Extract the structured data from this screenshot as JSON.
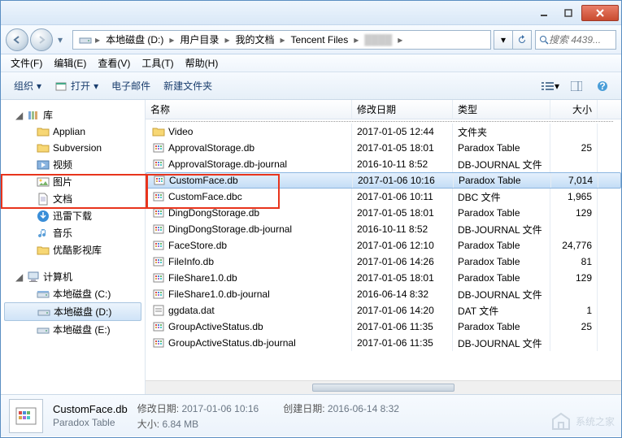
{
  "breadcrumb": {
    "drive": "本地磁盘 (D:)",
    "p1": "用户目录",
    "p2": "我的文档",
    "p3": "Tencent Files"
  },
  "search": {
    "placeholder": "搜索 4439..."
  },
  "menu": {
    "file": "文件(F)",
    "edit": "编辑(E)",
    "view": "查看(V)",
    "tools": "工具(T)",
    "help": "帮助(H)"
  },
  "toolbar": {
    "organize": "组织",
    "open": "打开",
    "email": "电子邮件",
    "newfolder": "新建文件夹"
  },
  "tree": {
    "library": "库",
    "applian": "Applian",
    "subversion": "Subversion",
    "video": "视频",
    "picture": "图片",
    "document": "文档",
    "xunlei": "迅雷下载",
    "music": "音乐",
    "youku": "优酷影视库",
    "computer": "计算机",
    "diskC": "本地磁盘 (C:)",
    "diskD": "本地磁盘 (D:)",
    "diskE": "本地磁盘 (E:)"
  },
  "cols": {
    "name": "名称",
    "date": "修改日期",
    "type": "类型",
    "size": "大小"
  },
  "rows": [
    {
      "n": "Video",
      "d": "2017-01-05 12:44",
      "t": "文件夹",
      "s": "",
      "i": "folder"
    },
    {
      "n": "ApprovalStorage.db",
      "d": "2017-01-05 18:01",
      "t": "Paradox Table",
      "s": "25",
      "i": "db"
    },
    {
      "n": "ApprovalStorage.db-journal",
      "d": "2016-10-11 8:52",
      "t": "DB-JOURNAL 文件",
      "s": "",
      "i": "db"
    },
    {
      "n": "CustomFace.db",
      "d": "2017-01-06 10:16",
      "t": "Paradox Table",
      "s": "7,014",
      "i": "db",
      "sel": true
    },
    {
      "n": "CustomFace.dbc",
      "d": "2017-01-06 10:11",
      "t": "DBC 文件",
      "s": "1,965",
      "i": "db"
    },
    {
      "n": "DingDongStorage.db",
      "d": "2017-01-05 18:01",
      "t": "Paradox Table",
      "s": "129",
      "i": "db"
    },
    {
      "n": "DingDongStorage.db-journal",
      "d": "2016-10-11 8:52",
      "t": "DB-JOURNAL 文件",
      "s": "",
      "i": "db"
    },
    {
      "n": "FaceStore.db",
      "d": "2017-01-06 12:10",
      "t": "Paradox Table",
      "s": "24,776",
      "i": "db"
    },
    {
      "n": "FileInfo.db",
      "d": "2017-01-06 14:26",
      "t": "Paradox Table",
      "s": "81",
      "i": "db"
    },
    {
      "n": "FileShare1.0.db",
      "d": "2017-01-05 18:01",
      "t": "Paradox Table",
      "s": "129",
      "i": "db"
    },
    {
      "n": "FileShare1.0.db-journal",
      "d": "2016-06-14 8:32",
      "t": "DB-JOURNAL 文件",
      "s": "",
      "i": "db"
    },
    {
      "n": "ggdata.dat",
      "d": "2017-01-06 14:20",
      "t": "DAT 文件",
      "s": "1",
      "i": "dat"
    },
    {
      "n": "GroupActiveStatus.db",
      "d": "2017-01-06 11:35",
      "t": "Paradox Table",
      "s": "25",
      "i": "db"
    },
    {
      "n": "GroupActiveStatus.db-journal",
      "d": "2017-01-06 11:35",
      "t": "DB-JOURNAL 文件",
      "s": "",
      "i": "db"
    }
  ],
  "details": {
    "name": "CustomFace.db",
    "type": "Paradox Table",
    "modlabel": "修改日期:",
    "mod": "2017-01-06 10:16",
    "crelabel": "创建日期:",
    "cre": "2016-06-14 8:32",
    "sizelabel": "大小:",
    "size": "6.84 MB"
  },
  "watermark": "系统之家"
}
